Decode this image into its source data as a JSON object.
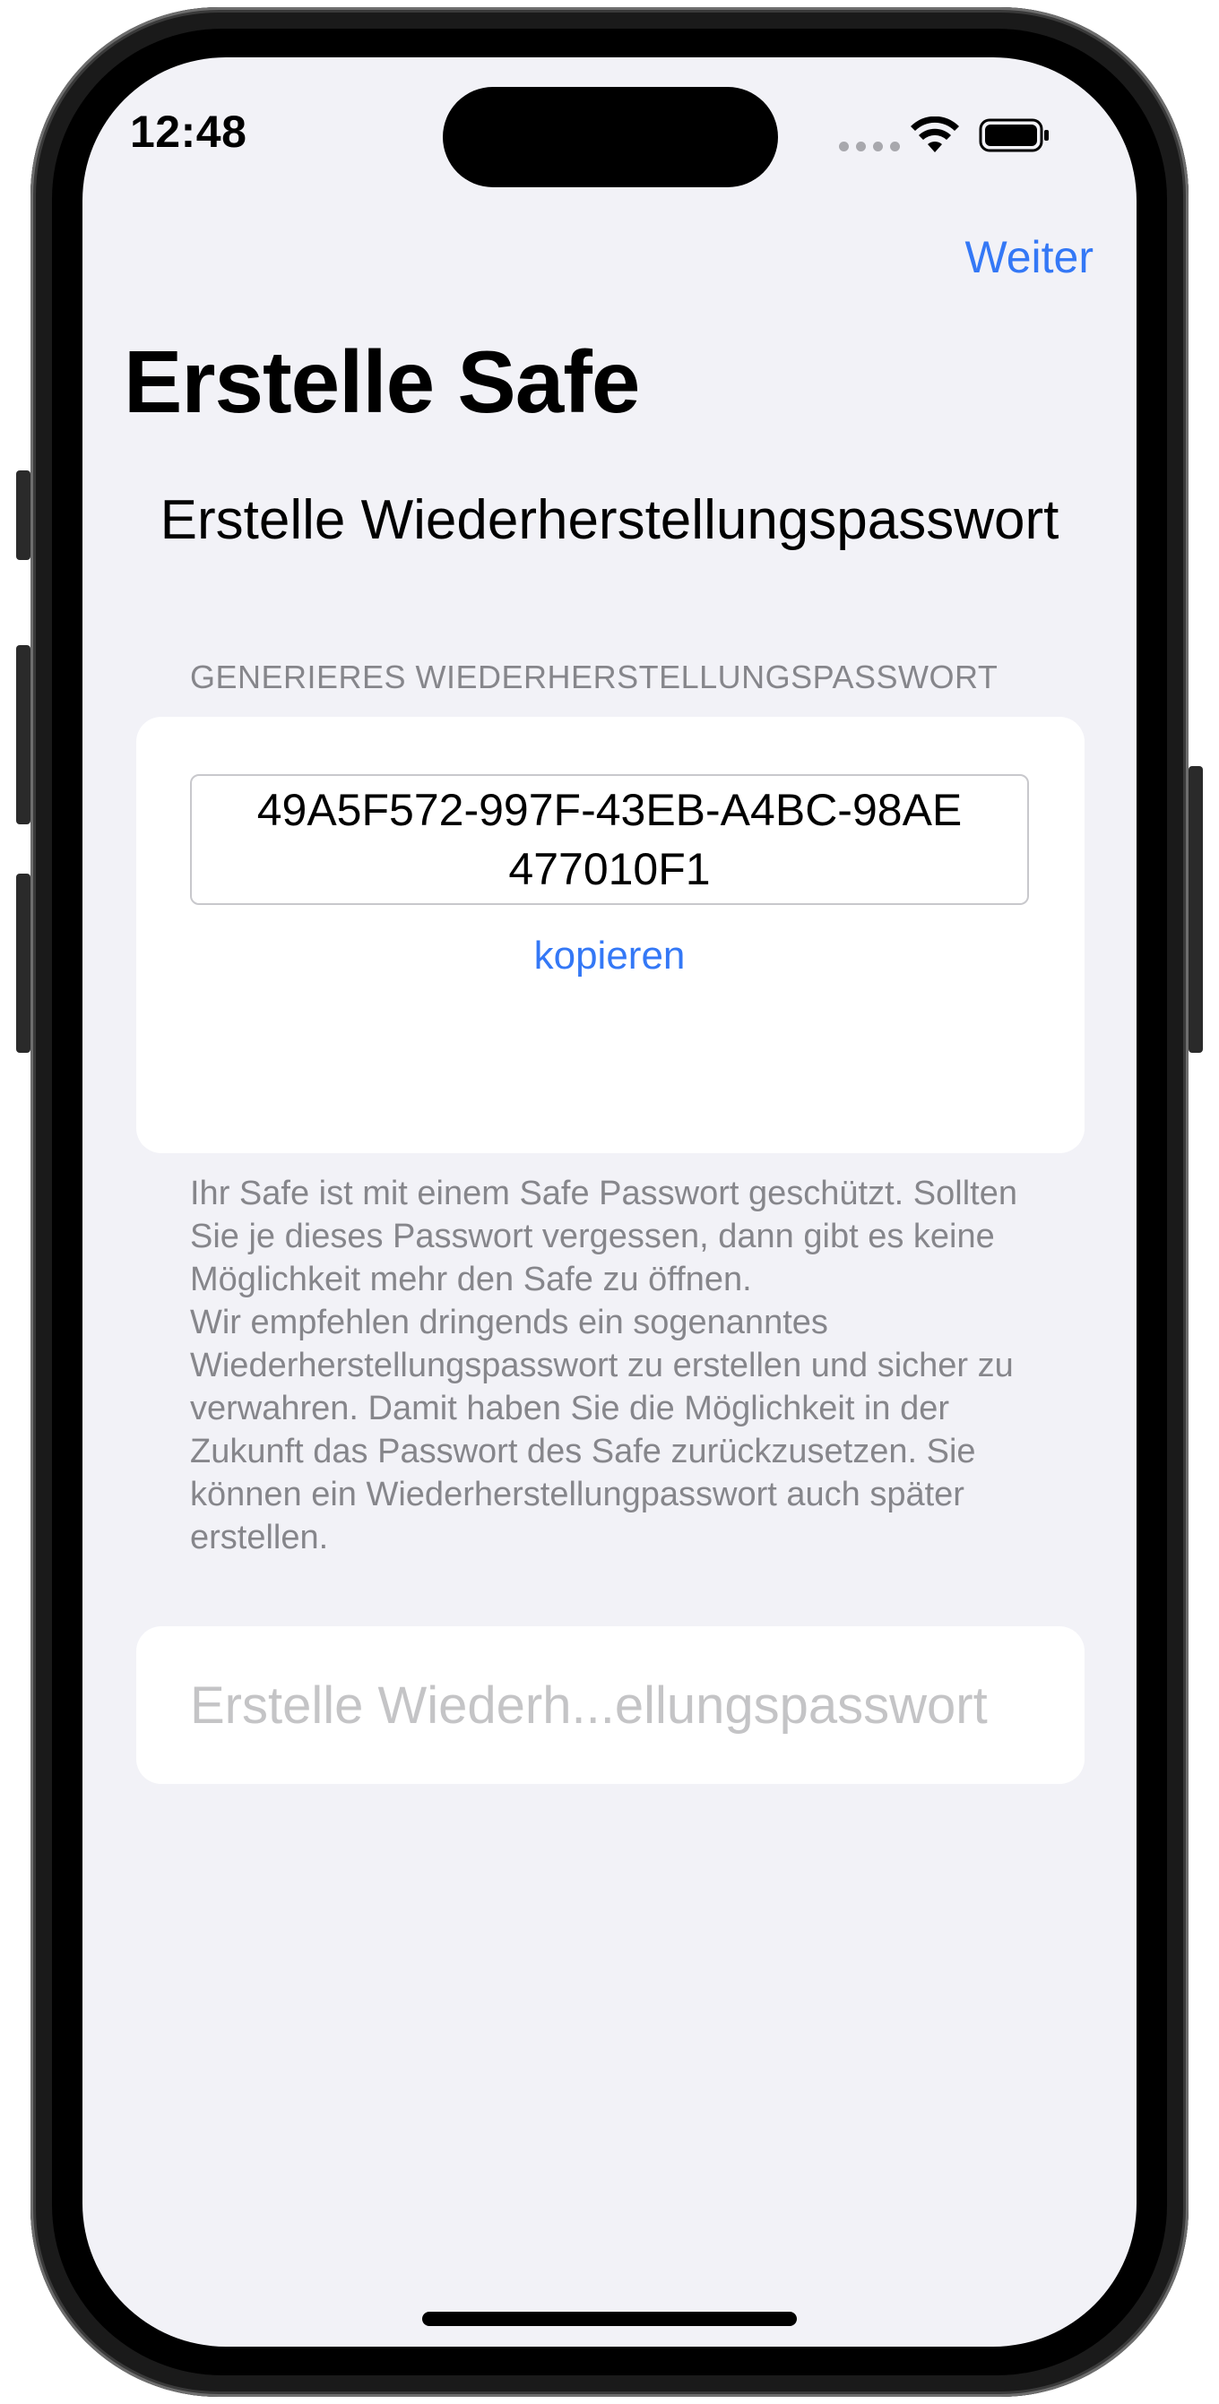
{
  "status_bar": {
    "time": "12:48",
    "icons": [
      "cellular-signal-icon",
      "wifi-icon",
      "battery-icon"
    ]
  },
  "nav": {
    "next_label": "Weiter"
  },
  "header": {
    "title": "Erstelle Safe",
    "subtitle": "Erstelle Wiederherstellungspasswort"
  },
  "recovery": {
    "section_header": "GENERIERES WIEDERHERSTELLUNGSPASSWORT",
    "password": "49A5F572-997F-43EB-A4BC-98AE477010F1",
    "copy_label": "kopieren",
    "footnote": "Ihr Safe ist mit einem Safe Passwort geschützt. Sollten Sie je dieses Passwort vergessen, dann gibt es keine Möglichkeit mehr den Safe zu öffnen.\nWir empfehlen dringends ein sogenanntes Wiederherstellungspasswort zu erstellen und sicher zu verwahren. Damit haben Sie die Möglichkeit in der Zukunft das Passwort des Safe zurückzusetzen. Sie können ein Wiederherstellungpasswort auch später erstellen."
  },
  "action": {
    "create_label": "Erstelle Wiederh...ellungspasswort"
  },
  "colors": {
    "accent": "#3478f6",
    "background": "#f2f2f7",
    "secondary_text": "#86868b",
    "disabled_text": "#c4c4c6"
  }
}
